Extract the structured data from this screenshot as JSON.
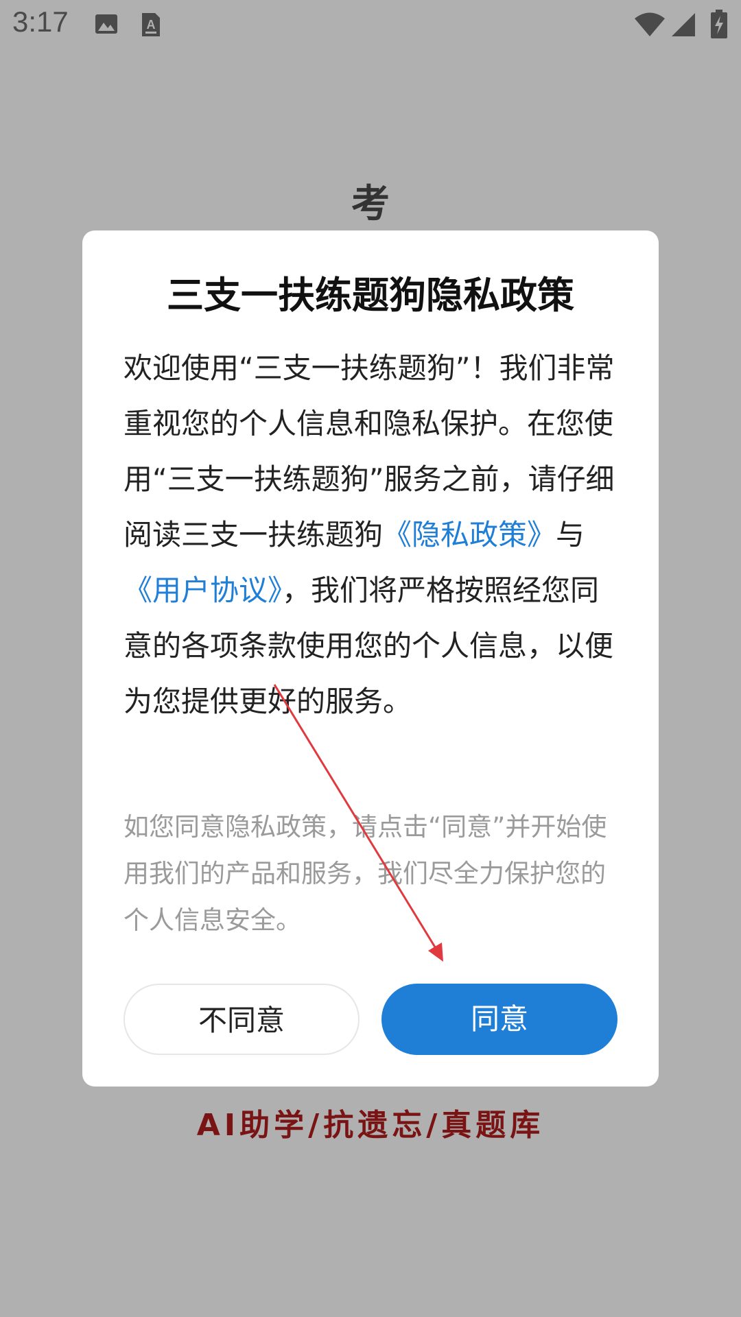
{
  "status_bar": {
    "time": "3:17",
    "icons": [
      "image-notification-icon",
      "text-notification-icon",
      "wifi-icon",
      "signal-icon",
      "battery-charging-icon"
    ]
  },
  "splash": {
    "title": "考",
    "tagline": "AI助学/抗遗忘/真题库",
    "tagline_color": "#7a1414"
  },
  "dialog": {
    "title": "三支一扶练题狗隐私政策",
    "body_part1": "欢迎使用“三支一扶练题狗”！我们非常重视您的个人信息和隐私保护。在您使用“三支一扶练题狗”服务之前，请仔细阅读三支一扶练题狗",
    "privacy_policy_link": "《隐私政策》",
    "body_and": "与",
    "user_agreement_link": "《用户协议》",
    "body_part2": "，我们将严格按照经您同意的各项条款使用您的个人信息，以便为您提供更好的服务。",
    "note": "如您同意隐私政策，请点击“同意”并开始使用我们的产品和服务，我们尽全力保护您的个人信息安全。",
    "disagree_label": "不同意",
    "agree_label": "同意",
    "link_color": "#1f7fd6",
    "agree_color": "#1f7fd6"
  },
  "annotation": {
    "arrow_color": "#e0393e"
  }
}
